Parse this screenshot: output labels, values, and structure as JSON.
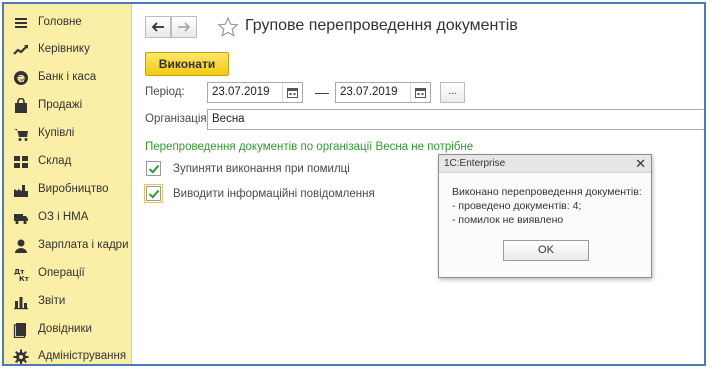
{
  "sidebar": {
    "items": [
      {
        "label": "Головне",
        "icon": "menu-lines-icon"
      },
      {
        "label": "Керівнику",
        "icon": "trend-chart-icon"
      },
      {
        "label": "Банк і каса",
        "icon": "currency-coin-icon"
      },
      {
        "label": "Продажі",
        "icon": "shopping-bag-icon"
      },
      {
        "label": "Купівлі",
        "icon": "shopping-cart-icon"
      },
      {
        "label": "Склад",
        "icon": "warehouse-grid-icon"
      },
      {
        "label": "Виробництво",
        "icon": "factory-icon"
      },
      {
        "label": "ОЗ і НМА",
        "icon": "truck-icon"
      },
      {
        "label": "Зарплата і кадри",
        "icon": "person-icon"
      },
      {
        "label": "Операції",
        "icon": "dt-kt-icon"
      },
      {
        "label": "Звіти",
        "icon": "bar-chart-icon"
      },
      {
        "label": "Довідники",
        "icon": "book-icon"
      },
      {
        "label": "Адміністрування",
        "icon": "gear-icon"
      }
    ]
  },
  "header": {
    "title": "Групове перепроведення документів"
  },
  "toolbar": {
    "run_label": "Виконати"
  },
  "form": {
    "period_label": "Період:",
    "date_from": "23.07.2019",
    "date_separator": "—",
    "date_to": "23.07.2019",
    "select_period_label": "...",
    "org_label": "Організація:",
    "org_value": "Весна",
    "status_message": "Перепроведення документів по організації Весна не потрібне",
    "stop_on_error_label": "Зупиняти виконання при помилці",
    "stop_on_error_checked": true,
    "show_info_label": "Виводити інформаційні повідомлення",
    "show_info_checked": true
  },
  "dialog": {
    "title": "1C:Enterprise",
    "close_label": "✕",
    "lines": [
      "Виконано перепроведення документів:",
      "- проведено документів: 4;",
      "- помилок не виявлено"
    ],
    "ok_label": "OK"
  },
  "colors": {
    "sidebar_bg": "#fbeea6",
    "accent_button": "#f5cf24",
    "status_green": "#2f9a2f",
    "frame_border": "#4a7ab8"
  }
}
